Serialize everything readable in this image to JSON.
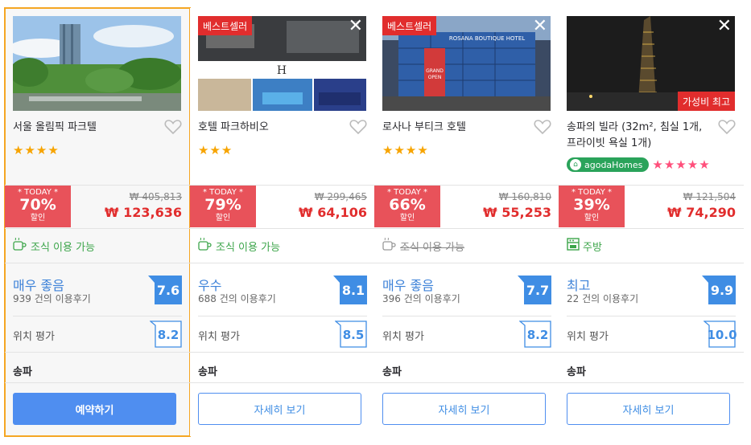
{
  "hotels": [
    {
      "name": "서울 올림픽 파크텔",
      "stars": "★★★★",
      "badge": "",
      "discount_tag": "* TODAY *",
      "discount": "70%",
      "discount_label": "할인",
      "old_price": "₩ 405,813",
      "new_price": "₩ 123,636",
      "amenity": "조식 이용 가능",
      "rating_word": "매우 좋음",
      "reviews": "939 건의 이용후기",
      "score": "7.6",
      "location_label": "위치 평가",
      "location_score": "8.2",
      "area": "송파",
      "button": "예약하기"
    },
    {
      "name": "호텔 파크하비오",
      "stars": "★★★",
      "badge": "베스트셀러",
      "discount_tag": "* TODAY *",
      "discount": "79%",
      "discount_label": "할인",
      "old_price": "₩ 299,465",
      "new_price": "₩ 64,106",
      "amenity": "조식 이용 가능",
      "rating_word": "우수",
      "reviews": "688 건의 이용후기",
      "score": "8.1",
      "location_label": "위치 평가",
      "location_score": "8.5",
      "area": "송파",
      "button": "자세히 보기"
    },
    {
      "name": "로사나 부티크 호텔",
      "stars": "★★★★",
      "badge": "베스트셀러",
      "discount_tag": "* TODAY *",
      "discount": "66%",
      "discount_label": "할인",
      "old_price": "₩ 160,810",
      "new_price": "₩ 55,253",
      "amenity": "조식 이용 가능",
      "rating_word": "매우 좋음",
      "reviews": "396 건의 이용후기",
      "score": "7.7",
      "location_label": "위치 평가",
      "location_score": "8.2",
      "area": "송파",
      "button": "자세히 보기"
    },
    {
      "name": "송파의 빌라 (32m², 침실 1개, 프라이빗 욕실 1개)",
      "stars": "★★★★★",
      "badge": "가성비 최고",
      "agoda": "agodaHomes",
      "discount_tag": "* TODAY *",
      "discount": "39%",
      "discount_label": "할인",
      "old_price": "₩ 121,504",
      "new_price": "₩ 74,290",
      "amenity": "주방",
      "rating_word": "최고",
      "reviews": "22 건의 이용후기",
      "score": "9.9",
      "location_label": "위치 평가",
      "location_score": "10.0",
      "area": "송파",
      "button": "자세히 보기"
    }
  ],
  "colors": {
    "accent_blue": "#4f8ef0",
    "discount_red": "#e8525a",
    "price_red": "#e12d2d",
    "amenity_green": "#3ca54a",
    "selected_border": "#f5a623"
  },
  "close_glyph": "✕"
}
